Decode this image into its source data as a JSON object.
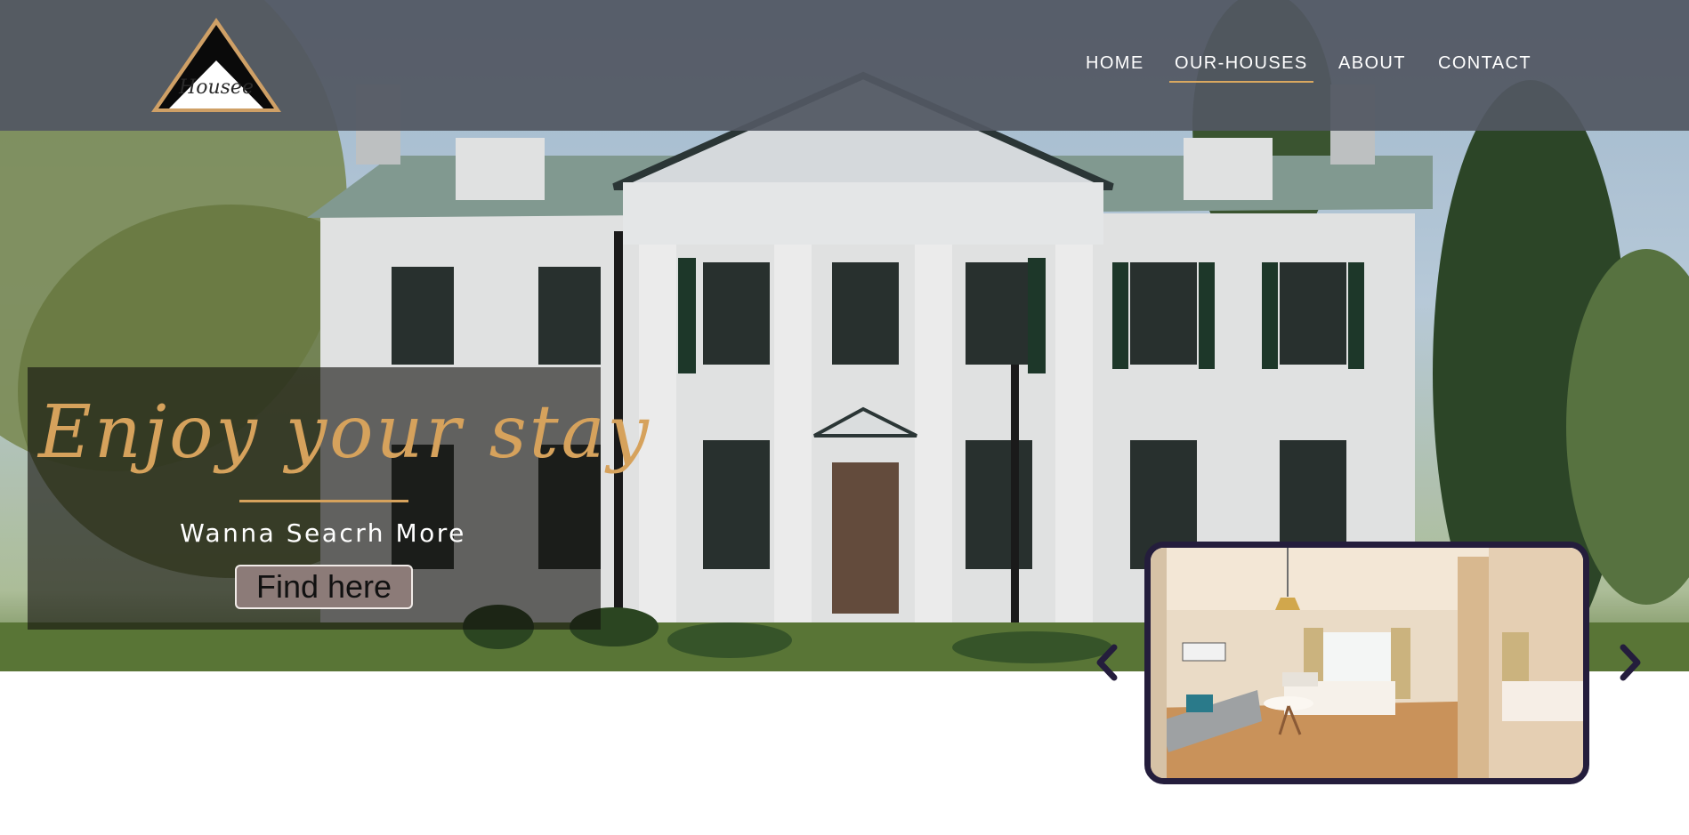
{
  "brand": {
    "logo_text": "Housee"
  },
  "nav": {
    "items": [
      {
        "label": "HOME"
      },
      {
        "label": "OUR-HOUSES"
      },
      {
        "label": "ABOUT"
      },
      {
        "label": "CONTACT"
      }
    ],
    "active_index": 1
  },
  "hero": {
    "title": "Enjoy your stay",
    "subtitle": "Wanna Seacrh More",
    "button_label": "Find here"
  },
  "carousel": {
    "prev_icon": "chevron-left-icon",
    "next_icon": "chevron-right-icon"
  },
  "colors": {
    "accent": "#d6a25c",
    "nav_bg": "#525762",
    "carousel_border": "#241d3c",
    "button_bg": "#8c7b78"
  }
}
